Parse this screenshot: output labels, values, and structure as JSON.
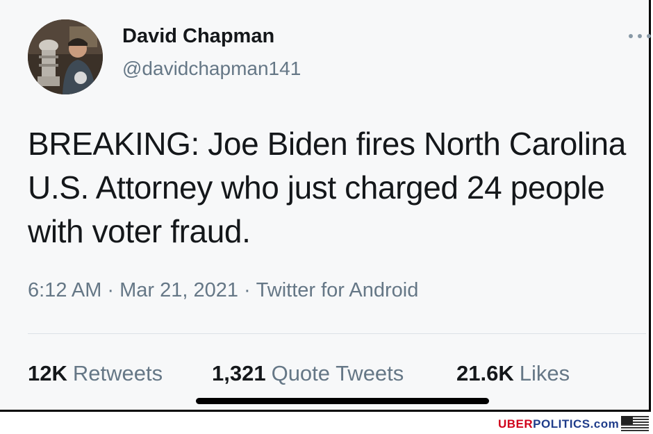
{
  "tweet": {
    "author": {
      "display_name": "David Chapman",
      "handle": "@davidchapman141"
    },
    "text": "BREAKING: Joe Biden fires North Carolina U.S. Attorney who just charged 24 people with voter fraud.",
    "time": "6:12 AM",
    "date": "Mar 21, 2021",
    "source": "Twitter for Android",
    "separator": "·",
    "stats": {
      "retweets": {
        "count": "12K",
        "label": "Retweets"
      },
      "quotes": {
        "count": "1,321",
        "label": "Quote Tweets"
      },
      "likes": {
        "count": "21.6K",
        "label": "Likes"
      }
    }
  },
  "watermark": {
    "part1": "UBER",
    "part2": "POLITICS.com"
  },
  "colors": {
    "text_primary": "#14171a",
    "text_secondary": "#657786",
    "brand_red": "#d0021b",
    "brand_blue": "#1f3c8a"
  },
  "icons": {
    "more": "more-horizontal-icon",
    "flag": "us-flag-icon"
  }
}
